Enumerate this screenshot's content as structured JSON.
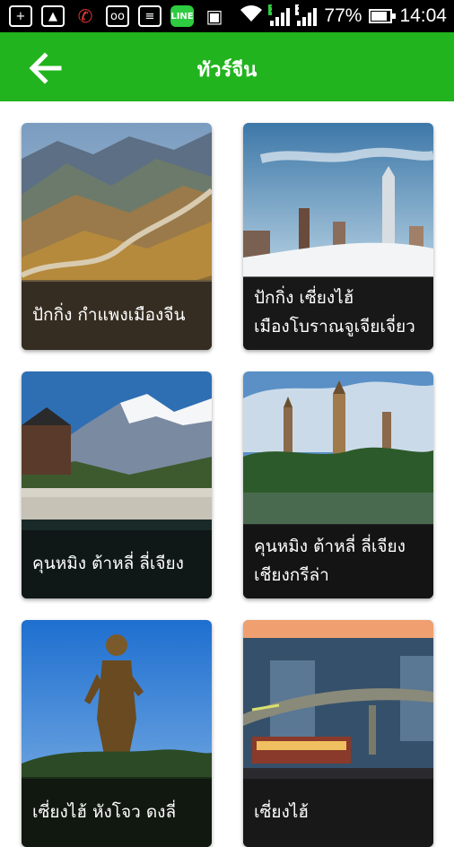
{
  "status_bar": {
    "battery": "77%",
    "time": "14:04",
    "sim1": "1",
    "sim2": "2",
    "line_icon": "LINE",
    "icons": [
      "plus-square-icon",
      "image-icon",
      "missed-call-icon",
      "voicemail-icon",
      "message-icon",
      "line-app-icon",
      "sim-error-icon",
      "wifi-icon"
    ]
  },
  "app_bar": {
    "title": "ทัวร์จีน",
    "back_icon": "arrow-left-icon",
    "color": "#22b41e"
  },
  "tours": [
    {
      "line1": "ปักกิ่ง กำแพงเมืองจีน",
      "line2": "",
      "image": "great-wall"
    },
    {
      "line1": "ปักกิ่ง เซี่ยงไฮ้",
      "line2": "เมืองโบราณจูเจียเจี่ยว",
      "image": "shanghai-skyline"
    },
    {
      "line1": "คุนหมิง ต้าหลี่ ลี่เจียง",
      "line2": "",
      "image": "jade-dragon-snow-mountain"
    },
    {
      "line1": "คุนหมิง ต้าหลี่ ลี่เจียง",
      "line2": "เชียงกรีล่า",
      "image": "three-pagodas"
    },
    {
      "line1": "เซี่ยงไฮ้ หังโจว ดงลี่",
      "line2": "",
      "image": "buddha-statue"
    },
    {
      "line1": "เซี่ยงไฮ้",
      "line2": "",
      "image": "city-night"
    }
  ]
}
